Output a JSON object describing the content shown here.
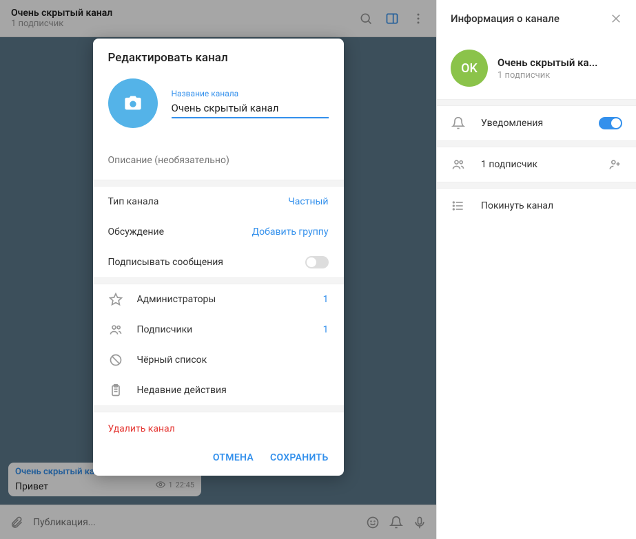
{
  "header": {
    "title": "Очень скрытый канал",
    "subtitle": "1 подписчик"
  },
  "message": {
    "sender": "Очень скрытый канал",
    "text": "Привет",
    "views": "1",
    "time": "22:45"
  },
  "input": {
    "placeholder": "Публикация..."
  },
  "sidebar": {
    "title": "Информация о канале",
    "avatar_initials": "OK",
    "channel_name": "Очень скрытый ка...",
    "subscribers": "1 подписчик",
    "notifications_label": "Уведомления",
    "subscribers_row": "1 подписчик",
    "leave_label": "Покинуть канал"
  },
  "dialog": {
    "title": "Редактировать канал",
    "name_label": "Название канала",
    "name_value": "Очень скрытый канал",
    "description_placeholder": "Описание (необязательно)",
    "type_label": "Тип канала",
    "type_value": "Частный",
    "discussion_label": "Обсуждение",
    "discussion_value": "Добавить группу",
    "sign_label": "Подписывать сообщения",
    "admins_label": "Администраторы",
    "admins_count": "1",
    "subscribers_label": "Подписчики",
    "subscribers_count": "1",
    "blacklist_label": "Чёрный список",
    "recent_label": "Недавние действия",
    "delete_label": "Удалить канал",
    "cancel": "ОТМЕНА",
    "save": "СОХРАНИТЬ"
  }
}
